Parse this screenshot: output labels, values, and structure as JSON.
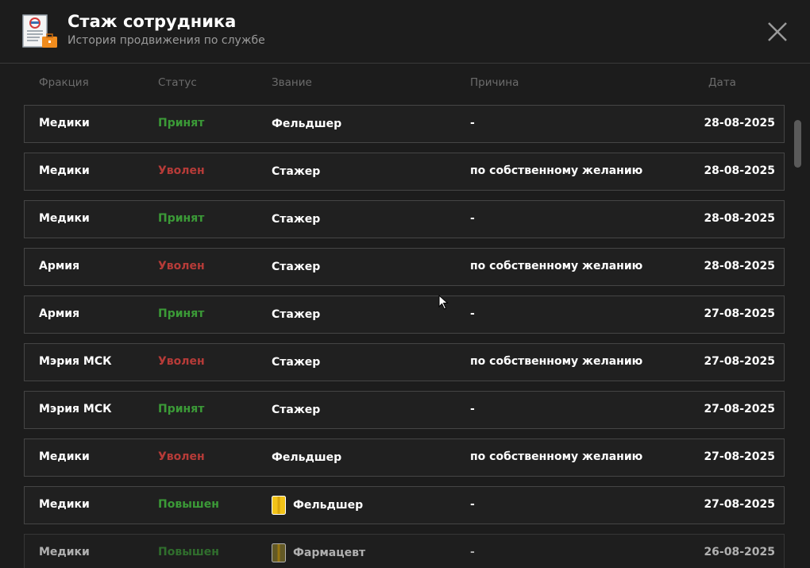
{
  "header": {
    "title": "Стаж сотрудника",
    "subtitle": "История продвижения по службе",
    "app_icon": "document-briefcase-icon",
    "close_icon": "close-icon"
  },
  "columns": {
    "faction": "Фракция",
    "status": "Статус",
    "rank": "Звание",
    "reason": "Причина",
    "date": "Дата"
  },
  "colors": {
    "background": "#1c1c1c",
    "accepted_green": "#3b9a37",
    "dismissed_red": "#b63b38",
    "row_border": "#454545",
    "badge_yellow": "#f2c318"
  },
  "rows": [
    {
      "faction": "Медики",
      "status": "Принят",
      "status_type": "green",
      "rank": "Фельдшер",
      "rank_badge": false,
      "reason": "-",
      "date": "28-08-2025"
    },
    {
      "faction": "Медики",
      "status": "Уволен",
      "status_type": "red",
      "rank": "Стажер",
      "rank_badge": false,
      "reason": "по собственному желанию",
      "date": "28-08-2025"
    },
    {
      "faction": "Медики",
      "status": "Принят",
      "status_type": "green",
      "rank": "Стажер",
      "rank_badge": false,
      "reason": "-",
      "date": "28-08-2025"
    },
    {
      "faction": "Армия",
      "status": "Уволен",
      "status_type": "red",
      "rank": "Стажер",
      "rank_badge": false,
      "reason": "по собственному желанию",
      "date": "28-08-2025"
    },
    {
      "faction": "Армия",
      "status": "Принят",
      "status_type": "green",
      "rank": "Стажер",
      "rank_badge": false,
      "reason": "-",
      "date": "27-08-2025"
    },
    {
      "faction": "Мэрия МСК",
      "status": "Уволен",
      "status_type": "red",
      "rank": "Стажер",
      "rank_badge": false,
      "reason": "по собственному желанию",
      "date": "27-08-2025"
    },
    {
      "faction": "Мэрия МСК",
      "status": "Принят",
      "status_type": "green",
      "rank": "Стажер",
      "rank_badge": false,
      "reason": "-",
      "date": "27-08-2025"
    },
    {
      "faction": "Медики",
      "status": "Уволен",
      "status_type": "red",
      "rank": "Фельдшер",
      "rank_badge": false,
      "reason": "по собственному желанию",
      "date": "27-08-2025"
    },
    {
      "faction": "Медики",
      "status": "Повышен",
      "status_type": "green",
      "rank": "Фельдшер",
      "rank_badge": true,
      "reason": "-",
      "date": "27-08-2025"
    },
    {
      "faction": "Медики",
      "status": "Повышен",
      "status_type": "green",
      "rank": "Фармацевт",
      "rank_badge": true,
      "reason": "-",
      "date": "26-08-2025"
    }
  ]
}
